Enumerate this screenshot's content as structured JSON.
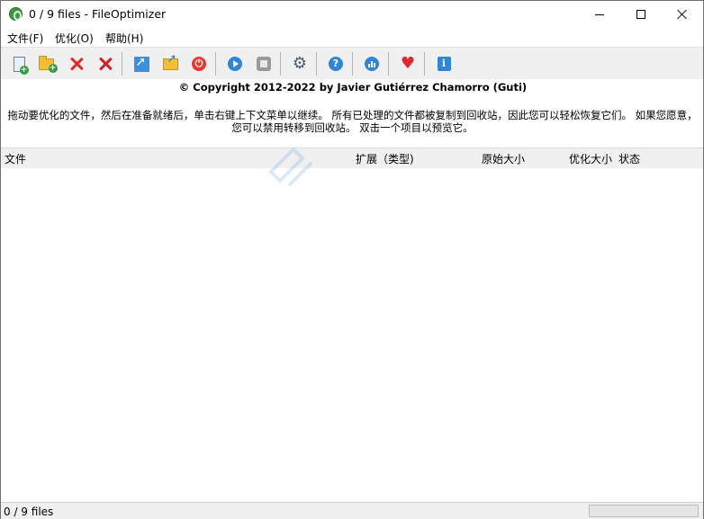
{
  "window": {
    "title": "0 / 9 files - FileOptimizer",
    "app_icon": "fileoptimizer-icon"
  },
  "menu": {
    "items": [
      {
        "label": "文件(F)"
      },
      {
        "label": "优化(O)"
      },
      {
        "label": "帮助(H)"
      }
    ]
  },
  "toolbar": {
    "buttons": [
      {
        "name": "add-files",
        "icon": "add-file-icon"
      },
      {
        "name": "add-folder",
        "icon": "add-folder-icon"
      },
      {
        "name": "clear-list",
        "icon": "clear-icon"
      },
      {
        "name": "remove",
        "icon": "remove-icon"
      },
      {
        "name": "open",
        "icon": "open-icon"
      },
      {
        "name": "open-folder",
        "icon": "open-folder-icon"
      },
      {
        "name": "exit",
        "icon": "power-icon"
      },
      {
        "name": "optimize",
        "icon": "play-icon"
      },
      {
        "name": "stop",
        "icon": "stop-icon"
      },
      {
        "name": "options",
        "icon": "gear-icon"
      },
      {
        "name": "help",
        "icon": "help-icon"
      },
      {
        "name": "statistics",
        "icon": "stats-icon"
      },
      {
        "name": "donate",
        "icon": "heart-icon"
      },
      {
        "name": "about",
        "icon": "info-icon"
      }
    ]
  },
  "copyright": "© Copyright 2012-2022 by Javier Gutiérrez Chamorro (Guti)",
  "instructions": "拖动要优化的文件，然后在准备就绪后，单击右键上下文菜单以继续。 所有已处理的文件都被复制到回收站，因此您可以轻松恢复它们。 如果您愿意，您可以禁用转移到回收站。 双击一个项目以预览它。",
  "list": {
    "columns": [
      {
        "label": "文件"
      },
      {
        "label": "扩展（类型)"
      },
      {
        "label": "原始大小"
      },
      {
        "label": "优化大小"
      },
      {
        "label": "状态"
      }
    ],
    "rows": []
  },
  "status": {
    "text": "0 / 9 files",
    "progress": 0
  },
  "colors": {
    "toolbar_bg": "#f0f0f0",
    "progress_fill": "#06b025",
    "accent_blue": "#2f86d6",
    "danger_red": "#e0282c"
  }
}
